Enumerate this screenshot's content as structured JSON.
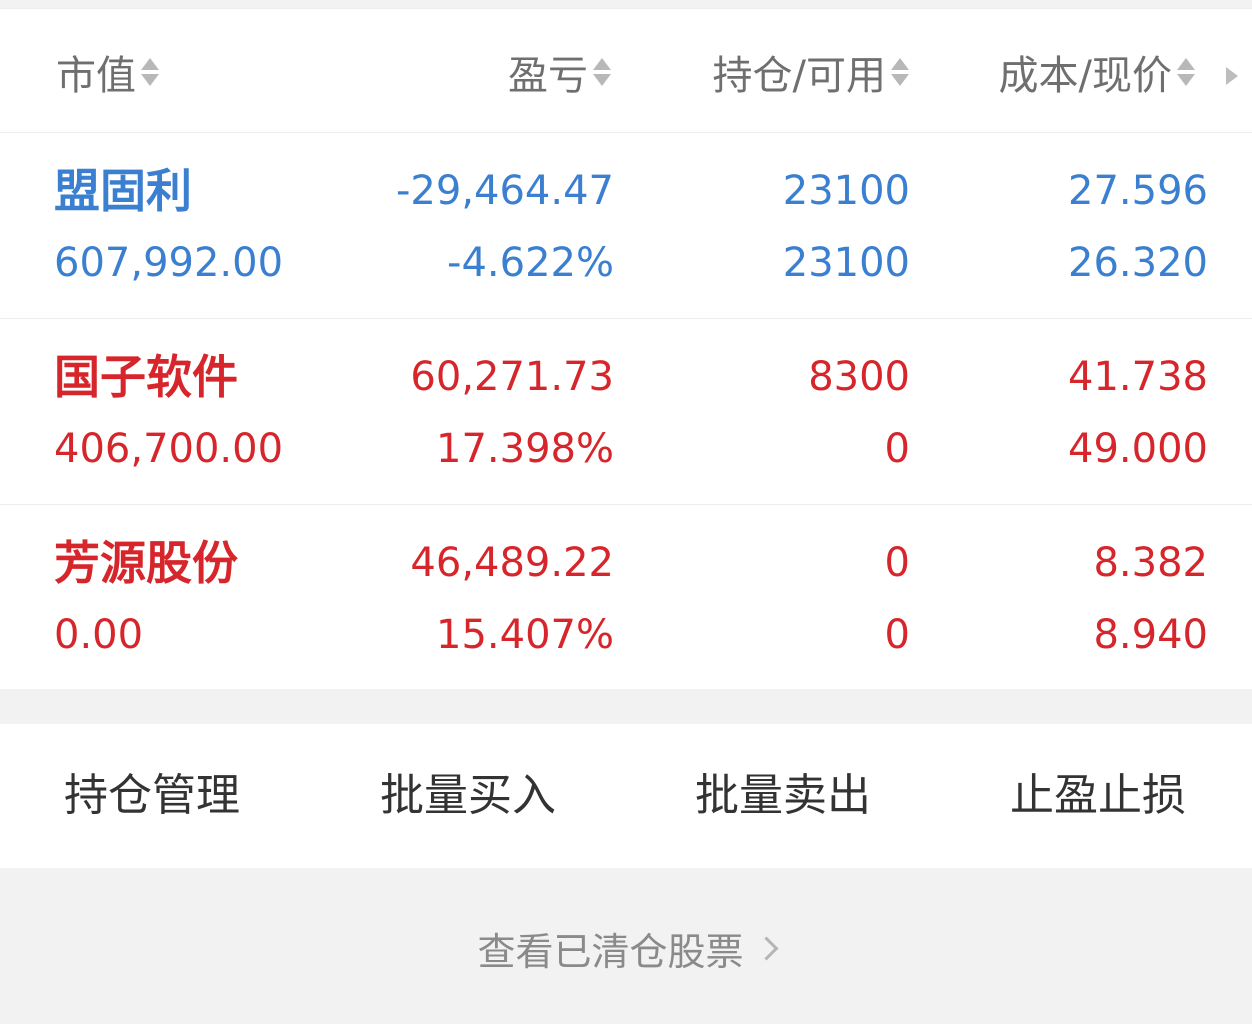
{
  "header": {
    "market_value": "市值",
    "profit_loss": "盈亏",
    "position_available": "持仓/可用",
    "cost_price": "成本/现价"
  },
  "holdings": [
    {
      "name": "盟固利",
      "market_value": "607,992.00",
      "profit_loss": "-29,464.47",
      "profit_loss_pct": "-4.622%",
      "position": "23100",
      "available": "23100",
      "cost": "27.596",
      "price": "26.320",
      "color": "#3a7fd0"
    },
    {
      "name": "国子软件",
      "market_value": "406,700.00",
      "profit_loss": "60,271.73",
      "profit_loss_pct": "17.398%",
      "position": "8300",
      "available": "0",
      "cost": "41.738",
      "price": "49.000",
      "color": "#d6262b"
    },
    {
      "name": "芳源股份",
      "market_value": "0.00",
      "profit_loss": "46,489.22",
      "profit_loss_pct": "15.407%",
      "position": "0",
      "available": "0",
      "cost": "8.382",
      "price": "8.940",
      "color": "#d6262b"
    }
  ],
  "actions": {
    "manage": "持仓管理",
    "batch_buy": "批量买入",
    "batch_sell": "批量卖出",
    "stop": "止盈止损"
  },
  "cleared_link": "查看已清仓股票",
  "icons": {
    "sort": "sort-updown-icon",
    "more": "triangle-right-icon",
    "chevron": "chevron-right-icon"
  }
}
